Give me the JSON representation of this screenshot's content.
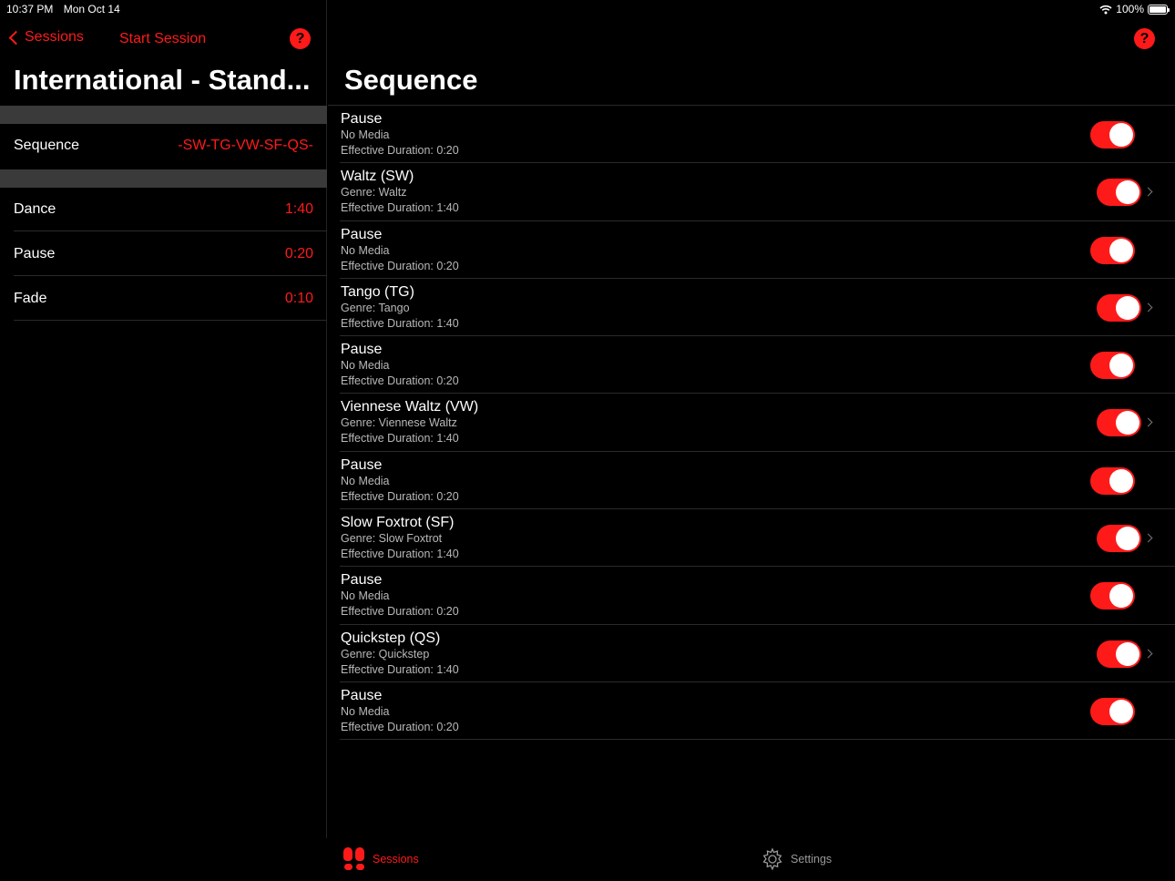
{
  "status_bar": {
    "time": "10:37 PM",
    "date": "Mon Oct 14",
    "battery": "100%"
  },
  "left_nav": {
    "back_label": "Sessions",
    "start_label": "Start Session",
    "help": "?"
  },
  "left_title": "International - Stand...",
  "sequence_row": {
    "label": "Sequence",
    "value": "-SW-TG-VW-SF-QS-"
  },
  "timing_rows": [
    {
      "label": "Dance",
      "value": "1:40"
    },
    {
      "label": "Pause",
      "value": "0:20"
    },
    {
      "label": "Fade",
      "value": "0:10"
    }
  ],
  "right_nav": {
    "help": "?"
  },
  "right_title": "Sequence",
  "items": [
    {
      "title": "Pause",
      "sub": "No Media",
      "duration": "Effective Duration: 0:20",
      "enabled": true,
      "chevron": false
    },
    {
      "title": "Waltz (SW)",
      "sub": "Genre: Waltz",
      "duration": "Effective Duration: 1:40",
      "enabled": true,
      "chevron": true
    },
    {
      "title": "Pause",
      "sub": "No Media",
      "duration": "Effective Duration: 0:20",
      "enabled": true,
      "chevron": false
    },
    {
      "title": "Tango (TG)",
      "sub": "Genre: Tango",
      "duration": "Effective Duration: 1:40",
      "enabled": true,
      "chevron": true
    },
    {
      "title": "Pause",
      "sub": "No Media",
      "duration": "Effective Duration: 0:20",
      "enabled": true,
      "chevron": false
    },
    {
      "title": "Viennese Waltz (VW)",
      "sub": "Genre: Viennese Waltz",
      "duration": "Effective Duration: 1:40",
      "enabled": true,
      "chevron": true
    },
    {
      "title": "Pause",
      "sub": "No Media",
      "duration": "Effective Duration: 0:20",
      "enabled": true,
      "chevron": false
    },
    {
      "title": "Slow Foxtrot (SF)",
      "sub": "Genre: Slow Foxtrot",
      "duration": "Effective Duration: 1:40",
      "enabled": true,
      "chevron": true
    },
    {
      "title": "Pause",
      "sub": "No Media",
      "duration": "Effective Duration: 0:20",
      "enabled": true,
      "chevron": false
    },
    {
      "title": "Quickstep (QS)",
      "sub": "Genre: Quickstep",
      "duration": "Effective Duration: 1:40",
      "enabled": true,
      "chevron": true
    },
    {
      "title": "Pause",
      "sub": "No Media",
      "duration": "Effective Duration: 0:20",
      "enabled": true,
      "chevron": false
    }
  ],
  "tabs": [
    {
      "label": "Sessions",
      "icon": "footprints-icon",
      "active": true
    },
    {
      "label": "Settings",
      "icon": "gear-icon",
      "active": false
    }
  ],
  "colors": {
    "accent": "#ff1a1a",
    "background": "#000000",
    "separator": "#3a3a3a"
  }
}
